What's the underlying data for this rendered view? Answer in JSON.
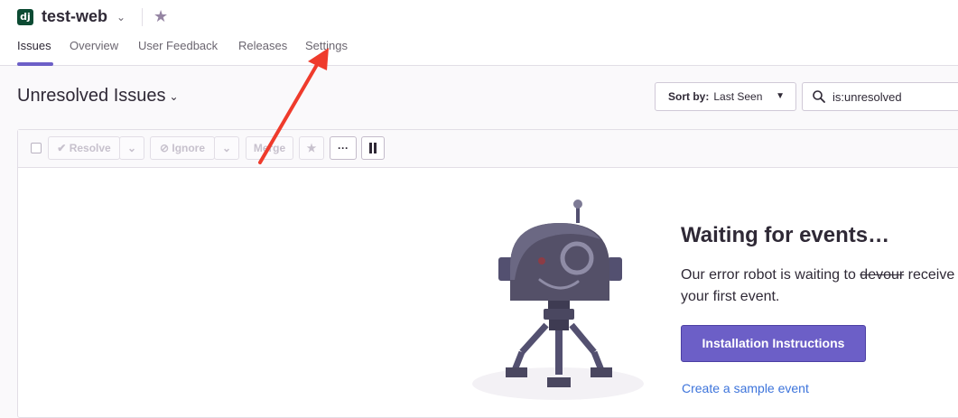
{
  "header": {
    "project_badge": "dj",
    "project_name": "test-web",
    "tabs": [
      {
        "label": "Issues",
        "active": true
      },
      {
        "label": "Overview"
      },
      {
        "label": "User Feedback"
      },
      {
        "label": "Releases"
      },
      {
        "label": "Settings"
      }
    ]
  },
  "page": {
    "title": "Unresolved Issues",
    "sort_prefix": "Sort by:",
    "sort_value": "Last Seen",
    "search_value": "is:unresolved"
  },
  "toolbar": {
    "resolve_label": "Resolve",
    "ignore_label": "Ignore",
    "merge_label": "Merge",
    "more_label": "···"
  },
  "empty_state": {
    "title": "Waiting for events…",
    "desc_before": "Our error robot is waiting to ",
    "desc_strike": "devour",
    "desc_after": " receive your first event.",
    "button_label": "Installation Instructions",
    "link_label": "Create a sample event"
  },
  "colors": {
    "accent": "#6c5fc7",
    "annotation_arrow": "#ef3b2c",
    "link": "#3d74db"
  },
  "icons": [
    "chevron-down-icon",
    "star-icon",
    "search-icon",
    "check-icon",
    "ban-icon",
    "pause-icon",
    "robot-illustration"
  ]
}
